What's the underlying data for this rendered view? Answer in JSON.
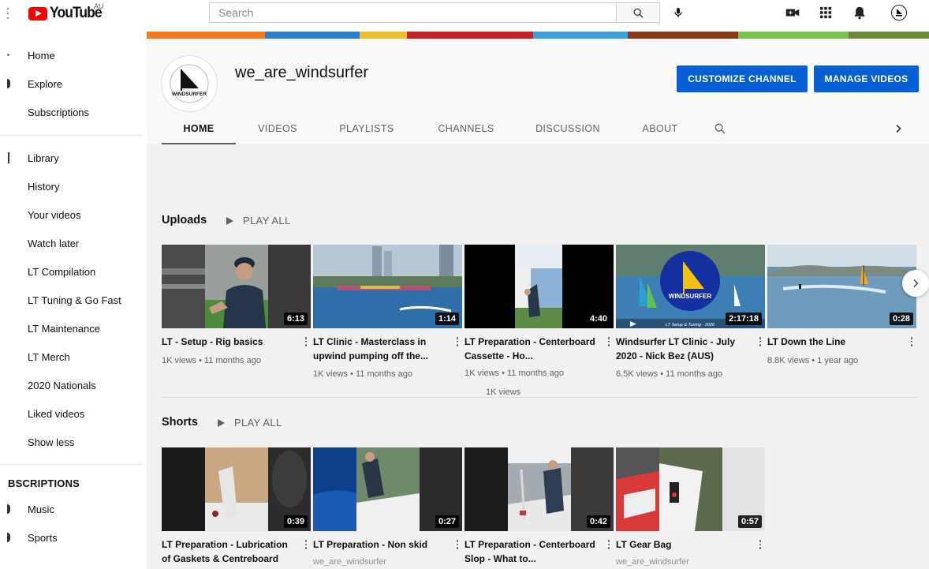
{
  "topbar": {
    "logo_text": "YouTube",
    "region": "AU",
    "search_placeholder": "Search"
  },
  "sidebar": {
    "items": [
      {
        "label": "Home"
      },
      {
        "label": "Explore"
      },
      {
        "label": "Subscriptions"
      },
      {
        "label": "Library"
      },
      {
        "label": "History"
      },
      {
        "label": "Your videos"
      },
      {
        "label": "Watch later"
      },
      {
        "label": "LT Compilation"
      },
      {
        "label": "LT Tuning & Go Fast"
      },
      {
        "label": "LT Maintenance"
      },
      {
        "label": "LT Merch"
      },
      {
        "label": "2020 Nationals"
      },
      {
        "label": "Liked videos"
      },
      {
        "label": "Show less"
      }
    ],
    "subscriptions_heading": "BSCRIPTIONS",
    "subscriptions": [
      {
        "label": "Music"
      },
      {
        "label": "Sports"
      }
    ]
  },
  "channel": {
    "name": "we_are_windsurfer",
    "avatar_logo_text": "WINDSURFER",
    "customize_label": "CUSTOMIZE CHANNEL",
    "manage_label": "MANAGE VIDEOS",
    "tabs": [
      {
        "label": "HOME",
        "active": true
      },
      {
        "label": "VIDEOS"
      },
      {
        "label": "PLAYLISTS"
      },
      {
        "label": "CHANNELS"
      },
      {
        "label": "DISCUSSION"
      },
      {
        "label": "ABOUT"
      }
    ]
  },
  "uploads": {
    "title": "Uploads",
    "play_all": "PLAY ALL",
    "videos": [
      {
        "title": "LT - Setup - Rig basics",
        "duration": "6:13",
        "meta": "1K views • 11 months ago"
      },
      {
        "title": "LT Clinic - Masterclass in upwind pumping off the...",
        "duration": "1:14",
        "meta": "1K views • 11 months ago"
      },
      {
        "title": "LT Preparation - Centerboard Cassette - Ho...",
        "duration": "4:40",
        "meta": "1K views • 11 months ago",
        "extra": "1K views"
      },
      {
        "title": "Windsurfer LT Clinic - July 2020 - Nick Bez (AUS)",
        "duration": "2:17:18",
        "meta": "6.5K views • 11 months ago",
        "thumb_logo": "WINDSURFER",
        "thumb_caption": "LT Setup & Tuning - 2020"
      },
      {
        "title": "LT Down the Line",
        "duration": "0:28",
        "meta": "8.8K views • 1 year ago"
      }
    ]
  },
  "shorts": {
    "title": "Shorts",
    "play_all": "PLAY ALL",
    "videos": [
      {
        "title": "LT Preparation - Lubrication of Gaskets & Centreboard",
        "duration": "0:39"
      },
      {
        "title": "LT Preparation - Non skid",
        "duration": "0:27",
        "channel": "we_are_windsurfer"
      },
      {
        "title": "LT Preparation - Centerboard Slop - What to...",
        "duration": "0:42"
      },
      {
        "title": "LT Gear Bag",
        "duration": "0:57",
        "channel": "we_are_windsurfer"
      }
    ]
  },
  "colors": {
    "brand_red": "#ff0000",
    "button_blue": "#065fd4"
  }
}
